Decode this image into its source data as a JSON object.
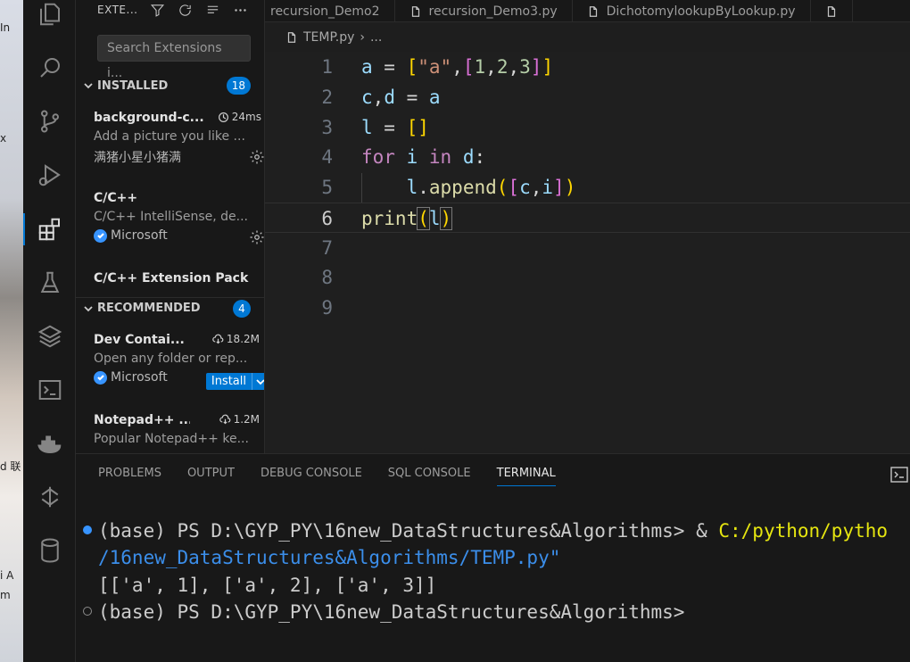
{
  "desktop": {
    "labels": [
      "In",
      "x",
      "d 联",
      "i A",
      "m"
    ]
  },
  "sidebar": {
    "title": "EXTE...",
    "search_placeholder": "Search Extensions i...",
    "installed": {
      "label": "INSTALLED",
      "count": "18",
      "items": [
        {
          "name": "background-c...",
          "time": "24ms",
          "desc": "Add a picture you like ...",
          "publisher": "满猪小星小猪满"
        },
        {
          "name": "C/C++",
          "desc": "C/C++ IntelliSense, de...",
          "publisher": "Microsoft"
        },
        {
          "name": "C/C++ Extension Pack"
        }
      ]
    },
    "recommended": {
      "label": "RECOMMENDED",
      "count": "4",
      "items": [
        {
          "name": "Dev Contai...",
          "downloads": "18.2M",
          "desc": "Open any folder or rep...",
          "publisher": "Microsoft",
          "install": "Install"
        },
        {
          "name": "Notepad++ ...",
          "downloads": "1.2M",
          "desc": "Popular Notepad++ ke..."
        }
      ]
    }
  },
  "tabs": [
    "recursion_Demo2",
    "recursion_Demo3.py",
    "DichotomylookupByLookup.py"
  ],
  "breadcrumb": {
    "file": "TEMP.py",
    "rest": "..."
  },
  "editor": {
    "line_numbers": [
      "1",
      "2",
      "3",
      "4",
      "5",
      "6",
      "7",
      "8",
      "9"
    ],
    "lines": [
      "a = [\"a\",[1,2,3]]",
      "c,d = a",
      "l = []",
      "for i in d:",
      "    l.append([c,i])",
      "print(l)"
    ]
  },
  "panel": {
    "tabs": [
      "PROBLEMS",
      "OUTPUT",
      "DEBUG CONSOLE",
      "SQL CONSOLE",
      "TERMINAL"
    ],
    "active_tab": "TERMINAL",
    "terminal": {
      "prompt1": "(base) PS D:\\GYP_PY\\16new_DataStructures&Algorithms> & ",
      "cmd_path": "C:/python/pytho",
      "cmd_cont": "/16new_DataStructures&Algorithms/TEMP.py\"",
      "output": "[['a', 1], ['a', 2], ['a', 3]]",
      "prompt2": "(base) PS D:\\GYP_PY\\16new_DataStructures&Algorithms>"
    }
  },
  "colors": {
    "accent": "#0078d4",
    "badge": "#0078d4",
    "keyword": "#c586c0",
    "variable": "#9cdcfe",
    "string": "#ce9178"
  }
}
